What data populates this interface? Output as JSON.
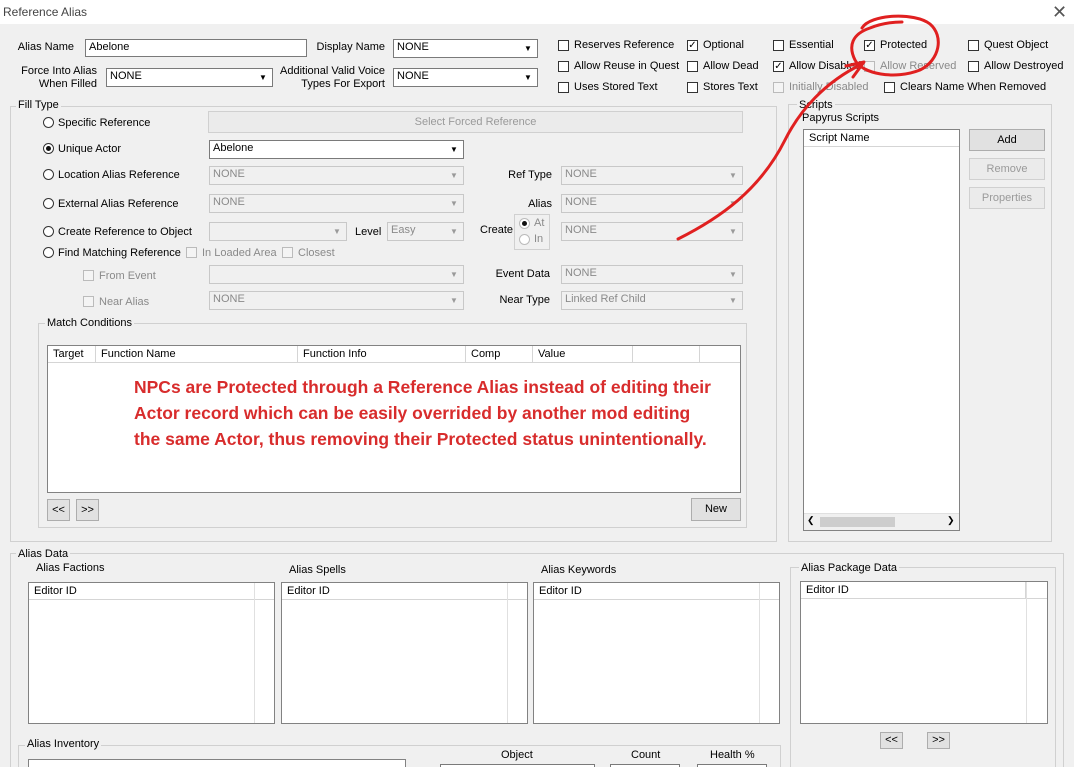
{
  "window": {
    "title": "Reference Alias",
    "close_glyph": "✕"
  },
  "header": {
    "alias_name_label": "Alias Name",
    "alias_name_value": "Abelone",
    "display_name_label": "Display Name",
    "display_name_value": "NONE",
    "force_into_alias_label_1": "Force Into Alias",
    "force_into_alias_label_2": "When Filled",
    "force_into_alias_value": "NONE",
    "voice_types_label_1": "Additional Valid Voice",
    "voice_types_label_2": "Types For Export",
    "voice_types_value": "NONE"
  },
  "flags": [
    {
      "label": "Reserves Reference",
      "checked": false,
      "enabled": true
    },
    {
      "label": "Optional",
      "checked": true,
      "enabled": true
    },
    {
      "label": "Essential",
      "checked": false,
      "enabled": true
    },
    {
      "label": "Protected",
      "checked": true,
      "enabled": true
    },
    {
      "label": "Quest Object",
      "checked": false,
      "enabled": true
    },
    {
      "label": "Allow Reuse in Quest",
      "checked": false,
      "enabled": true
    },
    {
      "label": "Allow Dead",
      "checked": false,
      "enabled": true
    },
    {
      "label": "Allow Disabled",
      "checked": true,
      "enabled": true
    },
    {
      "label": "Allow Reserved",
      "checked": false,
      "enabled": false
    },
    {
      "label": "Allow Destroyed",
      "checked": false,
      "enabled": true
    },
    {
      "label": "Uses Stored Text",
      "checked": false,
      "enabled": true
    },
    {
      "label": "Stores Text",
      "checked": false,
      "enabled": true
    },
    {
      "label": "Initially Disabled",
      "checked": false,
      "enabled": false
    },
    {
      "label": "Clears Name When Removed",
      "checked": false,
      "enabled": true
    }
  ],
  "fill_type": {
    "group_label": "Fill Type",
    "specific_reference": "Specific Reference",
    "select_forced_reference": "Select Forced Reference",
    "unique_actor": "Unique Actor",
    "unique_actor_value": "Abelone",
    "location_alias_reference": "Location Alias Reference",
    "location_alias_value": "NONE",
    "ref_type_label": "Ref Type",
    "ref_type_value": "NONE",
    "external_alias_reference": "External Alias Reference",
    "external_alias_value": "NONE",
    "alias_label": "Alias",
    "alias_value": "NONE",
    "create_reference_to_object": "Create Reference to Object",
    "create_object_value": "",
    "level_label": "Level",
    "level_value": "Easy",
    "create_label": "Create",
    "create_at": "At",
    "create_in": "In",
    "create_value": "NONE",
    "find_matching_reference": "Find Matching Reference",
    "in_loaded_area": "In Loaded Area",
    "closest": "Closest",
    "from_event": "From Event",
    "from_event_value": "",
    "event_data_label": "Event Data",
    "event_data_value": "NONE",
    "near_alias": "Near Alias",
    "near_alias_value": "NONE",
    "near_type_label": "Near Type",
    "near_type_value": "Linked Ref Child"
  },
  "match_conditions": {
    "group_label": "Match Conditions",
    "columns": [
      "Target",
      "Function Name",
      "Function Info",
      "Comp",
      "Value",
      "",
      ""
    ],
    "prev_label": "<<",
    "next_label": ">>",
    "new_label": "New"
  },
  "annotation": {
    "lines": [
      "NPCs are Protected through a Reference Alias instead of editing their",
      "Actor record which can be easily overrided by another mod editing",
      "the same Actor, thus removing their Protected status unintentionally."
    ],
    "color": "#d82c2c"
  },
  "scripts": {
    "group_label": "Scripts",
    "sub_label": "Papyrus Scripts",
    "column": "Script Name",
    "add_label": "Add",
    "remove_label": "Remove",
    "properties_label": "Properties"
  },
  "alias_data": {
    "group_label": "Alias Data",
    "factions_label": "Alias Factions",
    "spells_label": "Alias Spells",
    "keywords_label": "Alias Keywords",
    "editor_id": "Editor ID",
    "package_label": "Alias Package Data",
    "inventory_label": "Alias Inventory",
    "object_label": "Object",
    "count_label": "Count",
    "health_label": "Health %",
    "pkg_prev": "<<",
    "pkg_next": ">>"
  }
}
